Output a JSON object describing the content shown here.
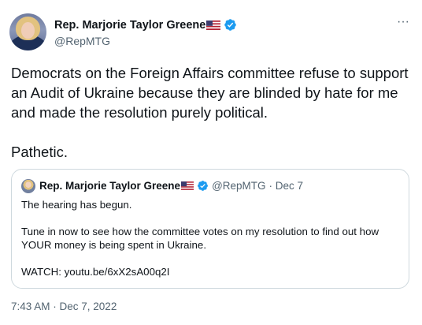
{
  "author": {
    "name": "Rep. Marjorie Taylor Greene",
    "handle": "@RepMTG",
    "flag_emoji": "us-flag",
    "verified_icon": "verified-badge-icon",
    "more_icon": "more-options-icon"
  },
  "tweet": {
    "paragraphs": [
      "Democrats on the Foreign Affairs committee refuse to support an Audit of Ukraine because they are blinded by hate for me and made the resolution purely political.",
      "Pathetic."
    ],
    "timestamp": "7:43 AM · Dec 7, 2022"
  },
  "quoted_tweet": {
    "name": "Rep. Marjorie Taylor Greene",
    "handle": "@RepMTG",
    "date": "· Dec 7",
    "paragraphs": [
      "The hearing has begun.",
      "Tune in now to see how the committee votes on my resolution to find out how YOUR money is being spent in Ukraine.",
      "WATCH: youtu.be/6xX2sA00q2I"
    ]
  },
  "colors": {
    "primary_text": "#0f1419",
    "secondary_text": "#536471",
    "verified_blue": "#1d9bf0",
    "border": "#cfd9de"
  }
}
